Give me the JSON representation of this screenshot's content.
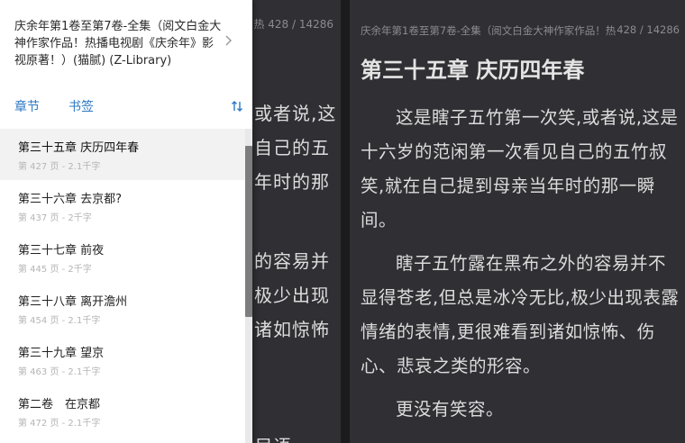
{
  "left_page": {
    "header_fragment": "热   428 / 14286",
    "text_fragments": [
      {
        "text": "或者说,这"
      },
      {
        "text": "自己的五"
      },
      {
        "text": "年时的那"
      },
      {
        "text": "的容易并"
      },
      {
        "text": "极少出现"
      },
      {
        "text": "诸如惊怖"
      },
      {
        "text": "尽语"
      }
    ]
  },
  "right_page": {
    "header_title": "庆余年第1卷至第7卷-全集（阅文白金大神作家作品！热",
    "page_counter": "428 / 14286",
    "chapter_title": "第三十五章 庆历四年春",
    "paragraphs": [
      "这是瞎子五竹第一次笑,或者说,这是十六岁的范闲第一次看见自己的五竹叔笑,就在自己提到母亲当年时的那一瞬间。",
      "瞎子五竹露在黑布之外的容易并不显得苍老,但总是冰冷无比,极少出现表露情绪的表情,更很难看到诸如惊怖、伤心、悲哀之类的形容。",
      "更没有笑容。"
    ]
  },
  "drawer": {
    "book_title": "庆余年第1卷至第7卷-全集（阅文白金大神作家作品！热播电视剧《庆余年》影视原著！）(猫腻) (Z-Library)",
    "tabs": {
      "toc": "章节",
      "bookmarks": "书签"
    },
    "chapters": [
      {
        "name": "第三十五章 庆历四年春",
        "meta": "第 427 页 - 2.1千字",
        "active": true
      },
      {
        "name": "第三十六章 去京都?",
        "meta": "第 437 页 - 2千字",
        "active": false
      },
      {
        "name": "第三十七章 前夜",
        "meta": "第 445 页 - 2千字",
        "active": false
      },
      {
        "name": "第三十八章 离开澹州",
        "meta": "第 454 页 - 2.1千字",
        "active": false
      },
      {
        "name": "第三十九章 望京",
        "meta": "第 463 页 - 2.1千字",
        "active": false
      },
      {
        "name": "第二卷　在京都",
        "meta": "第 472 页 - 2.1千字",
        "active": false
      }
    ],
    "scroll_position": 0.12
  },
  "colors": {
    "page_bg": "#2f2f34",
    "text": "#dcdcdc",
    "accent": "#2b78c5",
    "drawer_bg": "#ffffff"
  }
}
